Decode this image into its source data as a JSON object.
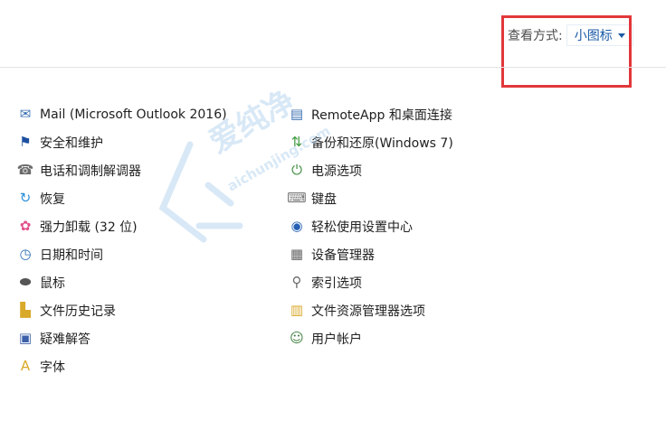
{
  "header": {
    "view_by_label": "查看方式:",
    "view_by_value": "小图标"
  },
  "items_left": [
    {
      "label": "Mail (Microsoft Outlook 2016)",
      "icon": "mail-icon"
    },
    {
      "label": "安全和维护",
      "icon": "flag-icon"
    },
    {
      "label": "电话和调制解调器",
      "icon": "phone-modem-icon"
    },
    {
      "label": "恢复",
      "icon": "recovery-icon"
    },
    {
      "label": "强力卸载 (32 位)",
      "icon": "uninstall-icon"
    },
    {
      "label": "日期和时间",
      "icon": "clock-icon"
    },
    {
      "label": "鼠标",
      "icon": "mouse-icon"
    },
    {
      "label": "文件历史记录",
      "icon": "file-history-icon"
    },
    {
      "label": "疑难解答",
      "icon": "troubleshoot-icon"
    },
    {
      "label": "字体",
      "icon": "font-icon"
    }
  ],
  "items_right": [
    {
      "label": "RemoteApp 和桌面连接",
      "icon": "remote-desktop-icon"
    },
    {
      "label": "备份和还原(Windows 7)",
      "icon": "backup-icon"
    },
    {
      "label": "电源选项",
      "icon": "power-icon"
    },
    {
      "label": "键盘",
      "icon": "keyboard-icon"
    },
    {
      "label": "轻松使用设置中心",
      "icon": "accessibility-icon"
    },
    {
      "label": "设备管理器",
      "icon": "device-manager-icon"
    },
    {
      "label": "索引选项",
      "icon": "index-icon"
    },
    {
      "label": "文件资源管理器选项",
      "icon": "file-explorer-options-icon"
    },
    {
      "label": "用户帐户",
      "icon": "user-accounts-icon"
    }
  ],
  "watermark": {
    "text_cn": "爱纯净",
    "text_en": "aichunjing.com"
  },
  "colors": {
    "highlight_box": "#e2373a",
    "link_blue": "#1a5aa6",
    "separator": "#e3e3e3"
  }
}
